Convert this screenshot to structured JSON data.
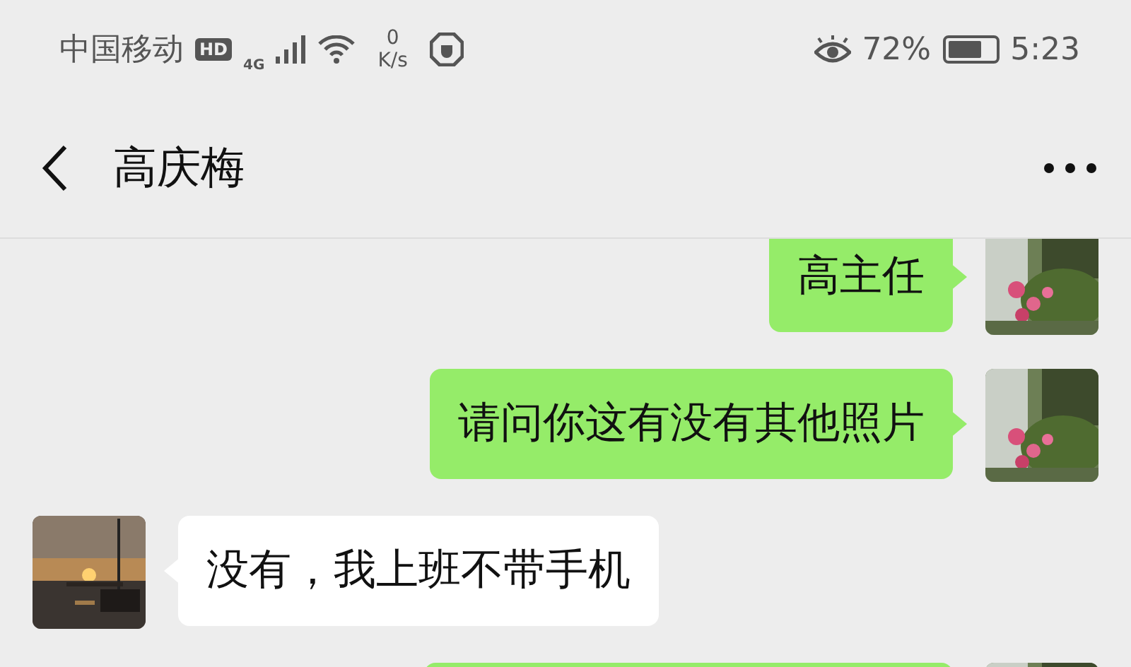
{
  "status_bar": {
    "carrier": "中国移动",
    "hd_badge": "HD",
    "network": "4G",
    "speed_value": "0",
    "speed_unit": "K/s",
    "eye_comfort": true,
    "battery_text": "72%",
    "battery": {
      "level": 0.72
    },
    "time": "5:23"
  },
  "header": {
    "title": "高庆梅"
  },
  "messages": [
    {
      "kind": "sent",
      "text": "高主任"
    },
    {
      "kind": "sent",
      "text": "请问你这有没有其他照片"
    },
    {
      "kind": "received",
      "text": "没有，我上班不带手机"
    },
    {
      "kind": "sent"
    }
  ]
}
